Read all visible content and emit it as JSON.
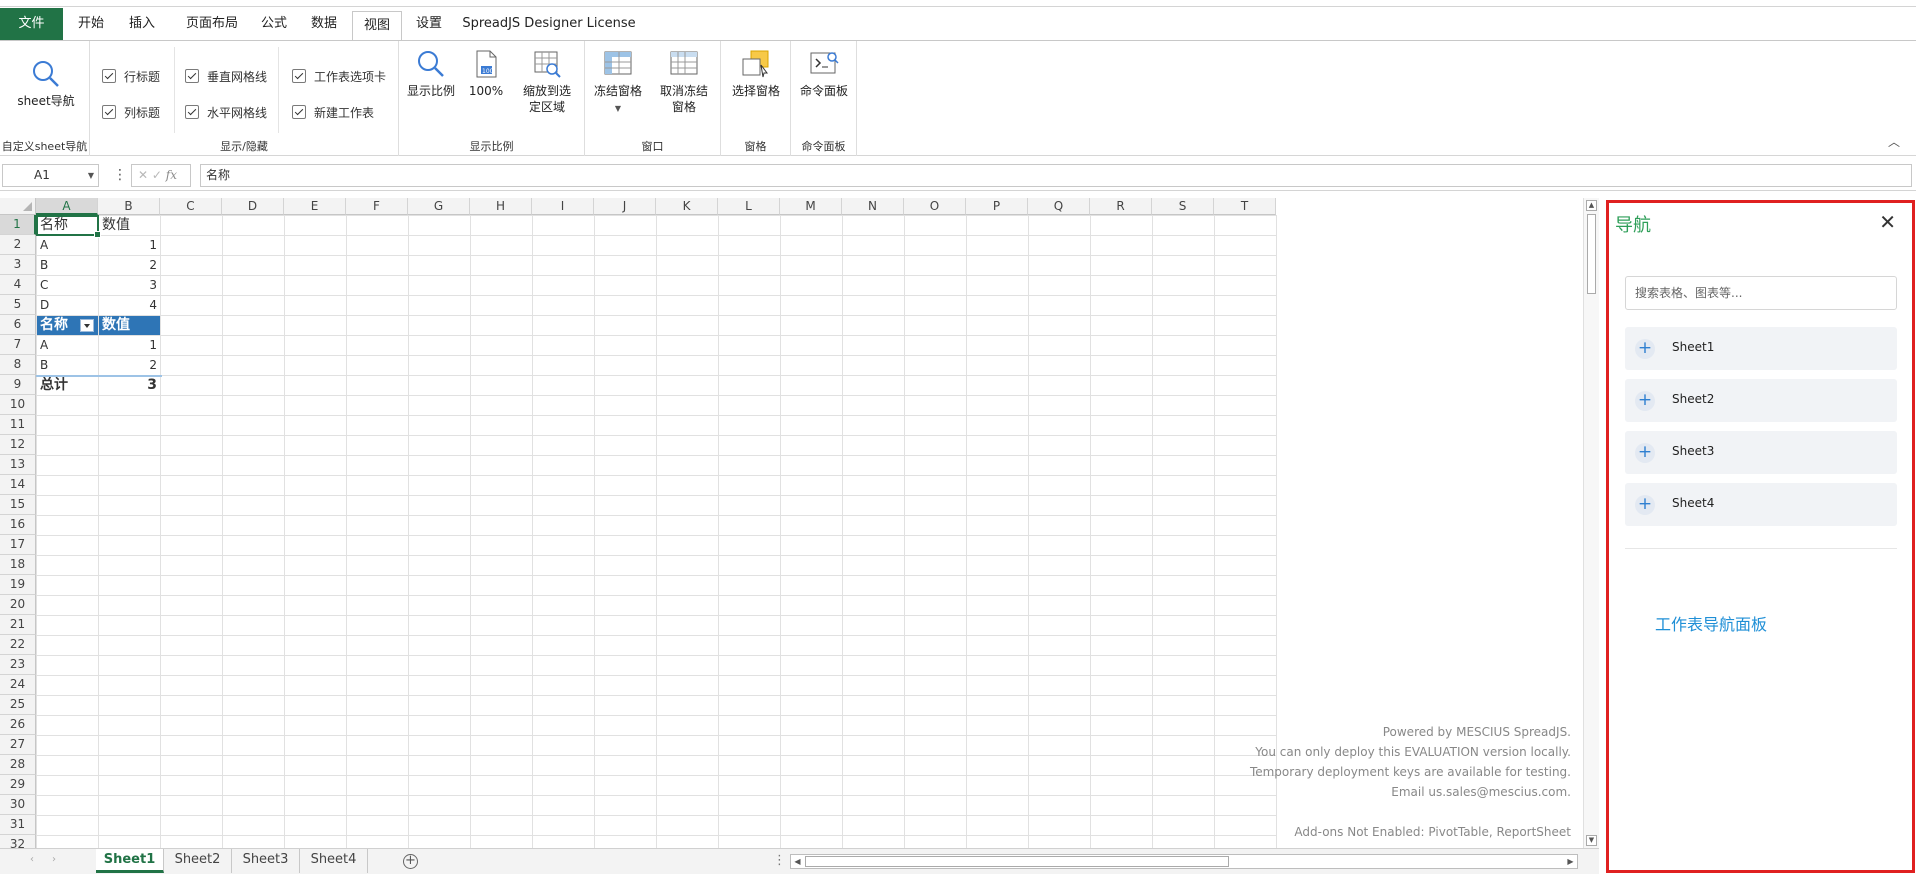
{
  "ribbon_tabs": [
    "文件",
    "开始",
    "插入",
    "页面布局",
    "公式",
    "数据",
    "视图",
    "设置",
    "SpreadJS Designer License"
  ],
  "active_tab": "视图",
  "ribbon": {
    "sheet_nav": {
      "button": "sheet导航",
      "group": "自定义sheet导航"
    },
    "show_hide": {
      "group": "显示/隐藏",
      "row_header": "行标题",
      "col_header": "列标题",
      "v_gridlines": "垂直网格线",
      "h_gridlines": "水平网格线",
      "sheet_tabs": "工作表选项卡",
      "new_sheet": "新建工作表"
    },
    "zoom": {
      "group": "显示比例",
      "zoom": "显示比例",
      "zoom100": "100%",
      "zoom_sel_1": "缩放到选",
      "zoom_sel_2": "定区域"
    },
    "window": {
      "group": "窗口",
      "freeze": "冻结窗格",
      "unfreeze_1": "取消冻结",
      "unfreeze_2": "窗格"
    },
    "panes": {
      "group": "窗格",
      "select_pane": "选择窗格"
    },
    "command": {
      "group": "命令面板",
      "command_panel": "命令面板"
    }
  },
  "formula_bar": {
    "name_box": "A1",
    "fx": "fx",
    "formula": "名称"
  },
  "grid": {
    "columns": [
      "A",
      "B",
      "C",
      "D",
      "E",
      "F",
      "G",
      "H",
      "I",
      "J",
      "K",
      "L",
      "M",
      "N",
      "O",
      "P",
      "Q",
      "R",
      "S",
      "T"
    ],
    "rows": [
      "1",
      "2",
      "3",
      "4",
      "5",
      "6",
      "7",
      "8",
      "9",
      "10",
      "11",
      "12",
      "13",
      "14",
      "15",
      "16",
      "17",
      "18",
      "19",
      "20",
      "21",
      "22",
      "23",
      "24",
      "25",
      "26",
      "27",
      "28",
      "29",
      "30",
      "31",
      "32"
    ],
    "cells": {
      "A1": "名称",
      "B1": "数值",
      "A2": "A",
      "B2": "1",
      "A3": "B",
      "B3": "2",
      "A4": "C",
      "B4": "3",
      "A5": "D",
      "B5": "4",
      "A6": "名称",
      "B6": "数值",
      "A7": "A",
      "B7": "1",
      "A8": "B",
      "B8": "2",
      "A9": "总计",
      "B9": "3"
    }
  },
  "watermark": [
    "Powered by MESCIUS SpreadJS.",
    "You can only deploy this EVALUATION version locally.",
    "Temporary deployment keys are available for testing.",
    "Email us.sales@mescius.com.",
    "Add-ons Not Enabled: PivotTable, ReportSheet"
  ],
  "sheet_tabs": [
    "Sheet1",
    "Sheet2",
    "Sheet3",
    "Sheet4"
  ],
  "active_sheet": "Sheet1",
  "nav_panel": {
    "title": "导航",
    "search_placeholder": "搜索表格、图表等...",
    "items": [
      "Sheet1",
      "Sheet2",
      "Sheet3",
      "Sheet4"
    ],
    "note": "工作表导航面板"
  },
  "colors": {
    "accent_green": "#217346",
    "table_header_blue": "#2e75b6",
    "panel_border_red": "#e02020",
    "panel_title_green": "#2e9e58",
    "note_blue": "#1f8fd6"
  }
}
